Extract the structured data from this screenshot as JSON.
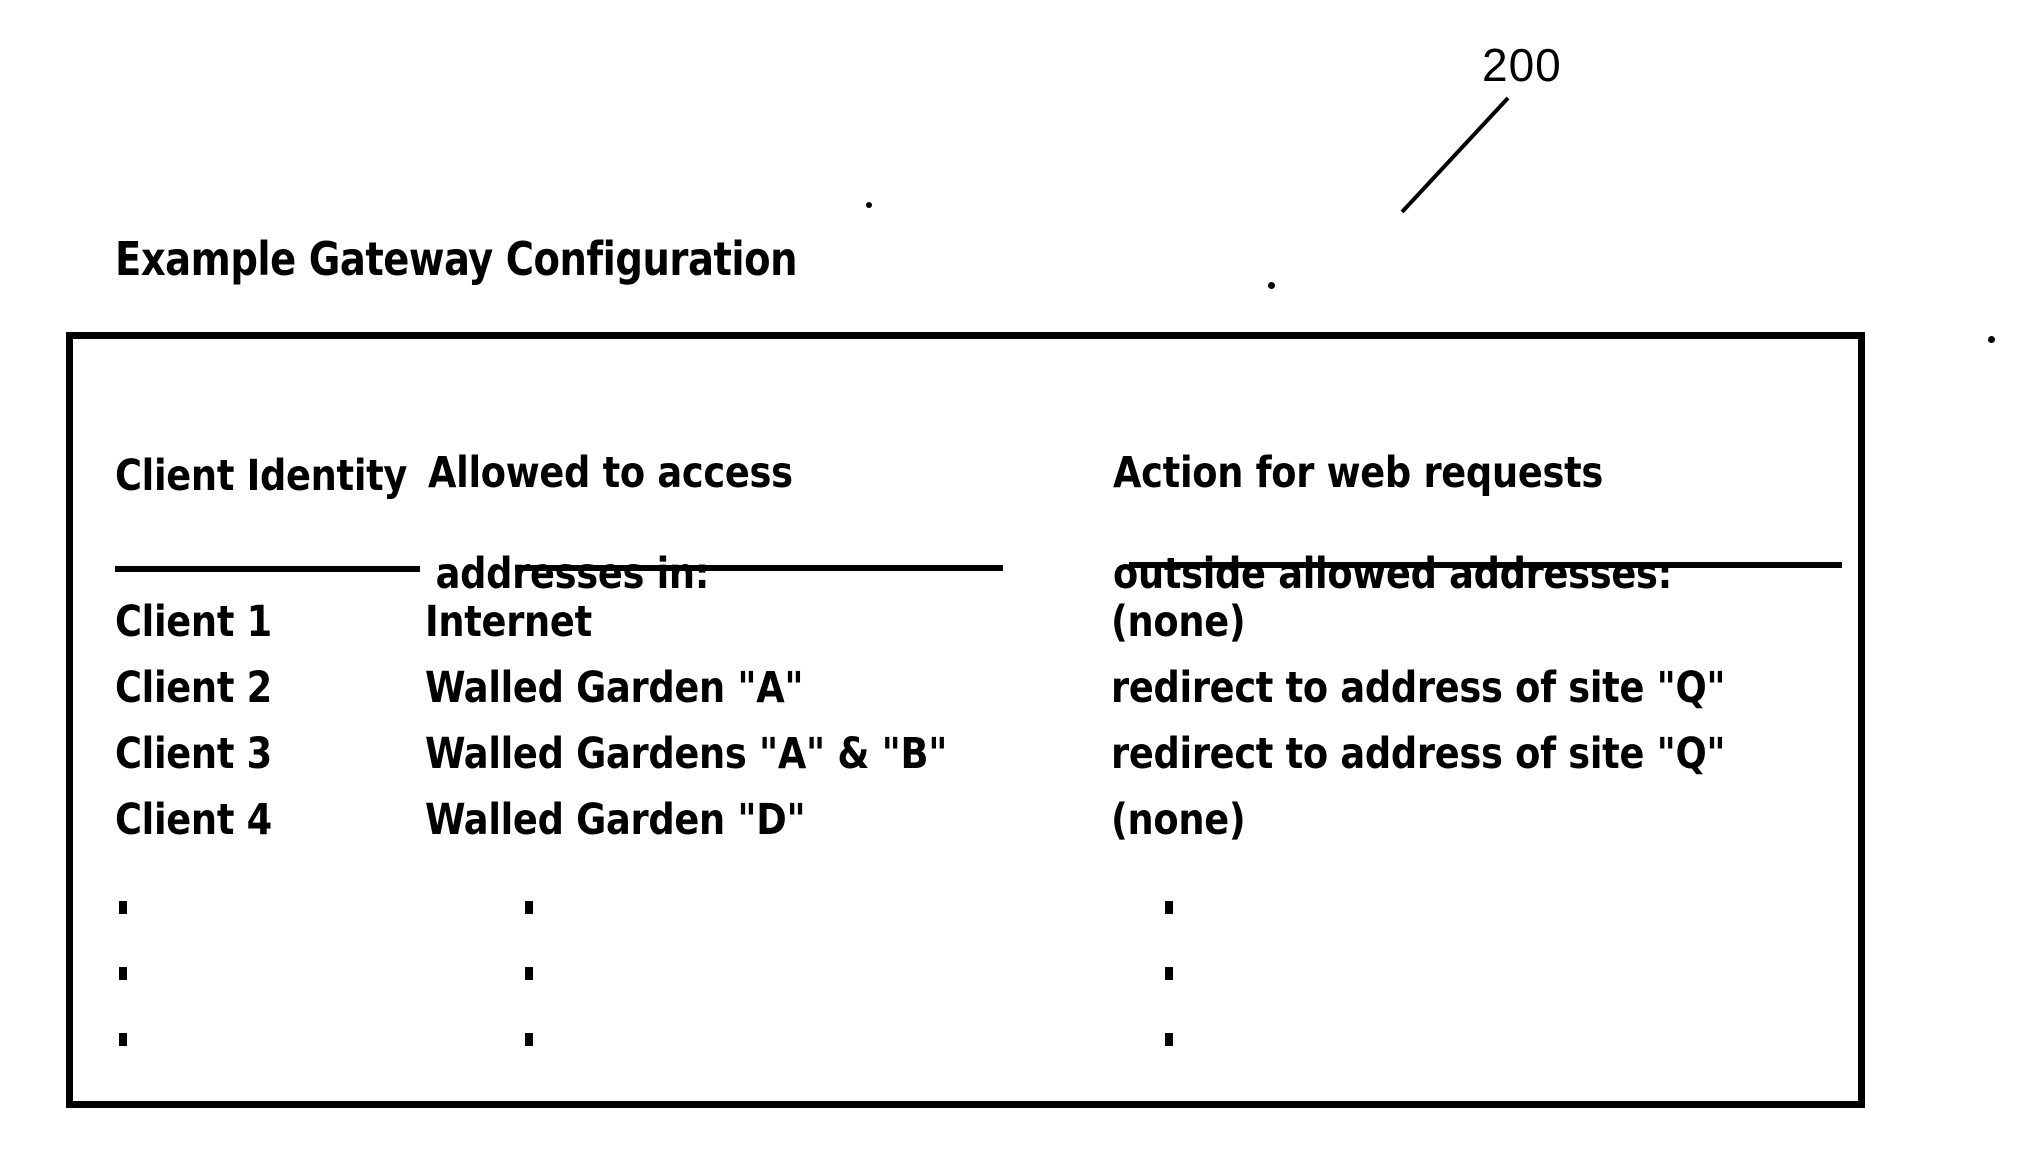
{
  "figure": {
    "reference_numeral": "200",
    "title": "Example Gateway Configuration"
  },
  "table": {
    "headers": [
      {
        "id": "client-identity",
        "line1": "Client Identity",
        "line2": ""
      },
      {
        "id": "allowed-addresses",
        "line1": "Allowed to access",
        "line2": "addresses in:"
      },
      {
        "id": "action-outside",
        "line1": "Action for web requests",
        "line2": "outside allowed addresses:"
      }
    ],
    "rows": [
      {
        "client": "Client 1",
        "allowed": "Internet",
        "action": "(none)"
      },
      {
        "client": "Client 2",
        "allowed": "Walled Garden \"A\"",
        "action": "redirect to address of site \"Q\""
      },
      {
        "client": "Client 3",
        "allowed": "Walled Gardens \"A\" & \"B\"",
        "action": "redirect to address of site \"Q\""
      },
      {
        "client": "Client 4",
        "allowed": "Walled Garden \"D\"",
        "action": "(none)"
      }
    ],
    "continuation": {
      "glyph": "vertical-ellipsis",
      "rows": 3,
      "columns": 3
    }
  },
  "colors": {
    "ink": "#000000",
    "paper": "#ffffff"
  }
}
